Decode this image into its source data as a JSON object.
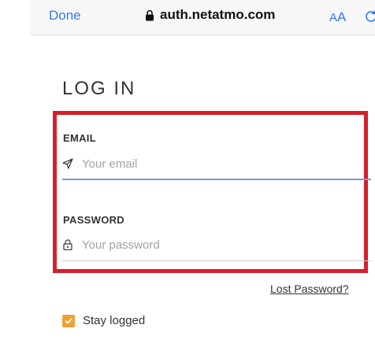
{
  "browser": {
    "done_label": "Done",
    "url": "auth.netatmo.com",
    "text_size_small": "A",
    "text_size_large": "A"
  },
  "form": {
    "title": "LOG IN",
    "email": {
      "label": "EMAIL",
      "placeholder": "Your email",
      "value": ""
    },
    "password": {
      "label": "PASSWORD",
      "placeholder": "Your password",
      "value": ""
    },
    "lost_password": "Lost Password?",
    "stay_logged": {
      "label": "Stay logged",
      "checked": true
    }
  },
  "colors": {
    "accent": "#3478f6",
    "highlight": "#d81e2b",
    "checkbox": "#f0a030",
    "focus_underline": "#7c96e8"
  },
  "icons": [
    "lock-icon",
    "reload-icon",
    "send-icon",
    "padlock-icon",
    "checkmark-icon"
  ]
}
